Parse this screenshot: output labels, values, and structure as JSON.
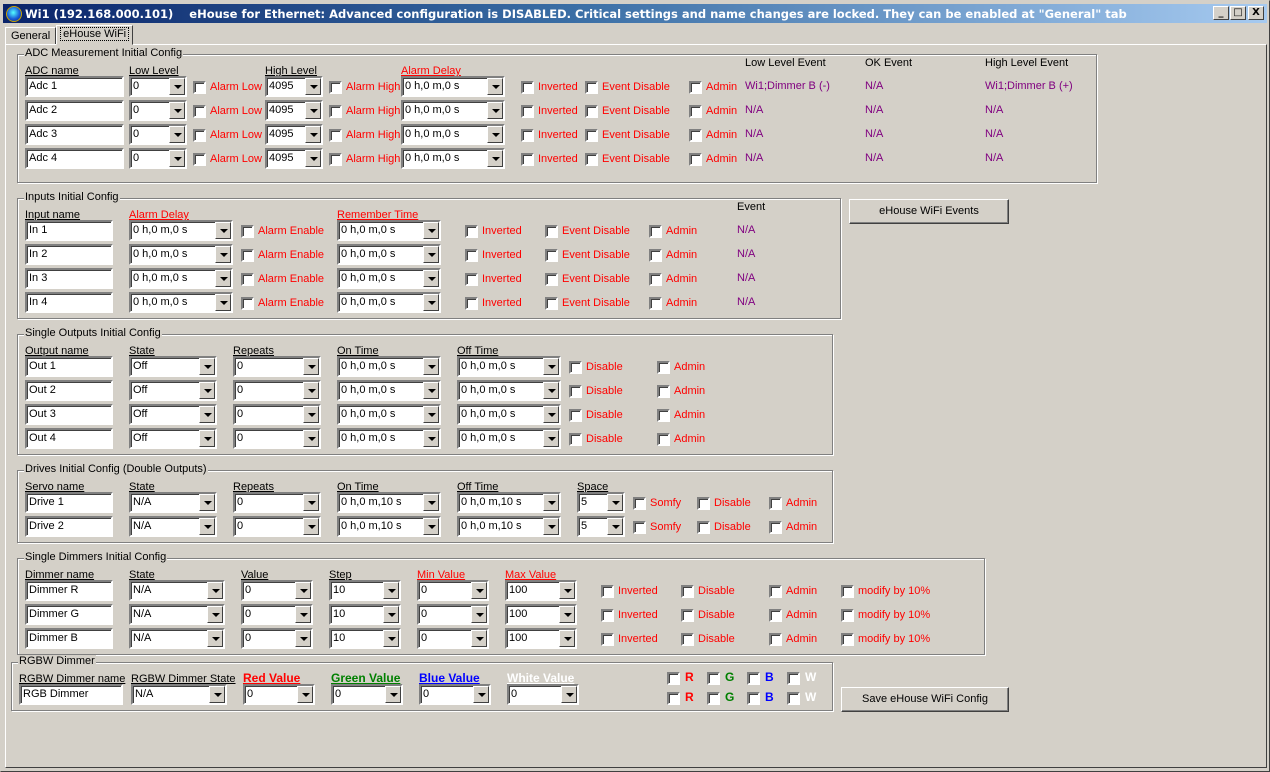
{
  "window": {
    "title": "Wi1 (192.168.000.101)    eHouse for Ethernet: Advanced configuration is DISABLED. Critical settings and name changes are locked. They can be enabled at \"General\" tab",
    "minimize": "_",
    "maximize": "□",
    "close": "X"
  },
  "tabs": [
    {
      "label": "General"
    },
    {
      "label": "eHouse WiFi",
      "active": true
    }
  ],
  "adc": {
    "title": "ADC Measurement Initial Config",
    "headers": {
      "name": "ADC name",
      "low": "Low Level",
      "high": "High Level",
      "delay": "Alarm Delay",
      "low_event": "Low Level Event",
      "ok_event": "OK Event",
      "high_event": "High Level Event"
    },
    "check_labels": {
      "alarm_low": "Alarm Low",
      "alarm_high": "Alarm High",
      "inverted": "Inverted",
      "event_disable": "Event Disable",
      "admin": "Admin"
    },
    "rows": [
      {
        "name": "Adc 1",
        "low": "0",
        "high": "4095",
        "delay": "0 h,0 m,0 s",
        "low_event": "Wi1;Dimmer B (-)",
        "ok_event": "N/A",
        "high_event": "Wi1;Dimmer B (+)"
      },
      {
        "name": "Adc 2",
        "low": "0",
        "high": "4095",
        "delay": "0 h,0 m,0 s",
        "low_event": "N/A",
        "ok_event": "N/A",
        "high_event": "N/A"
      },
      {
        "name": "Adc 3",
        "low": "0",
        "high": "4095",
        "delay": "0 h,0 m,0 s",
        "low_event": "N/A",
        "ok_event": "N/A",
        "high_event": "N/A"
      },
      {
        "name": "Adc 4",
        "low": "0",
        "high": "4095",
        "delay": "0 h,0 m,0 s",
        "low_event": "N/A",
        "ok_event": "N/A",
        "high_event": "N/A"
      }
    ]
  },
  "inputs": {
    "title": "Inputs Initial Config",
    "headers": {
      "name": "Input name",
      "delay": "Alarm Delay",
      "remember": "Remember Time",
      "event": "Event"
    },
    "check_labels": {
      "alarm_enable": "Alarm Enable",
      "inverted": "Inverted",
      "event_disable": "Event Disable",
      "admin": "Admin"
    },
    "rows": [
      {
        "name": "In 1",
        "delay": "0 h,0 m,0 s",
        "remember": "0 h,0 m,0 s",
        "event": "N/A"
      },
      {
        "name": "In 2",
        "delay": "0 h,0 m,0 s",
        "remember": "0 h,0 m,0 s",
        "event": "N/A"
      },
      {
        "name": "In 3",
        "delay": "0 h,0 m,0 s",
        "remember": "0 h,0 m,0 s",
        "event": "N/A"
      },
      {
        "name": "In 4",
        "delay": "0 h,0 m,0 s",
        "remember": "0 h,0 m,0 s",
        "event": "N/A"
      }
    ],
    "events_button": "eHouse WiFi Events"
  },
  "outputs": {
    "title": "Single Outputs Initial Config",
    "headers": {
      "name": "Output name",
      "state": "State",
      "repeats": "Repeats",
      "on_time": "On Time",
      "off_time": "Off Time"
    },
    "check_labels": {
      "disable": "Disable",
      "admin": "Admin"
    },
    "rows": [
      {
        "name": "Out 1",
        "state": "Off",
        "repeats": "0",
        "on_time": "0 h,0 m,0 s",
        "off_time": "0 h,0 m,0 s"
      },
      {
        "name": "Out 2",
        "state": "Off",
        "repeats": "0",
        "on_time": "0 h,0 m,0 s",
        "off_time": "0 h,0 m,0 s"
      },
      {
        "name": "Out 3",
        "state": "Off",
        "repeats": "0",
        "on_time": "0 h,0 m,0 s",
        "off_time": "0 h,0 m,0 s"
      },
      {
        "name": "Out 4",
        "state": "Off",
        "repeats": "0",
        "on_time": "0 h,0 m,0 s",
        "off_time": "0 h,0 m,0 s"
      }
    ]
  },
  "drives": {
    "title": "Drives Initial Config (Double Outputs)",
    "headers": {
      "name": "Servo name",
      "state": "State",
      "repeats": "Repeats",
      "on_time": "On Time",
      "off_time": "Off Time",
      "space": "Space"
    },
    "check_labels": {
      "somfy": "Somfy",
      "disable": "Disable",
      "admin": "Admin"
    },
    "rows": [
      {
        "name": "Drive 1",
        "state": "N/A",
        "repeats": "0",
        "on_time": "0 h,0 m,10 s",
        "off_time": "0 h,0 m,10 s",
        "space": "5"
      },
      {
        "name": "Drive 2",
        "state": "N/A",
        "repeats": "0",
        "on_time": "0 h,0 m,10 s",
        "off_time": "0 h,0 m,10 s",
        "space": "5"
      }
    ]
  },
  "dimmers": {
    "title": "Single Dimmers Initial Config",
    "headers": {
      "name": "Dimmer name",
      "state": "State",
      "value": "Value",
      "step": "Step",
      "min": "Min Value",
      "max": "Max Value"
    },
    "check_labels": {
      "inverted": "Inverted",
      "disable": "Disable",
      "admin": "Admin",
      "modify": "modify by 10%"
    },
    "rows": [
      {
        "name": "Dimmer R",
        "state": "N/A",
        "value": "0",
        "step": "10",
        "min": "0",
        "max": "100"
      },
      {
        "name": "Dimmer G",
        "state": "N/A",
        "value": "0",
        "step": "10",
        "min": "0",
        "max": "100"
      },
      {
        "name": "Dimmer B",
        "state": "N/A",
        "value": "0",
        "step": "10",
        "min": "0",
        "max": "100"
      }
    ]
  },
  "rgbw": {
    "title": "RGBW Dimmer",
    "headers": {
      "name": "RGBW Dimmer name",
      "state": "RGBW Dimmer State",
      "red": "Red Value",
      "green": "Green Value",
      "blue": "Blue Value",
      "white": "White Value"
    },
    "name": "RGB Dimmer",
    "state": "N/A",
    "red": "0",
    "green": "0",
    "blue": "0",
    "white": "0",
    "channel_labels": [
      "R",
      "G",
      "B",
      "W"
    ],
    "channel_colors": [
      "#ff0000",
      "#008000",
      "#0000ff",
      "#ffffff"
    ]
  },
  "save_button": "Save eHouse WiFi Config"
}
